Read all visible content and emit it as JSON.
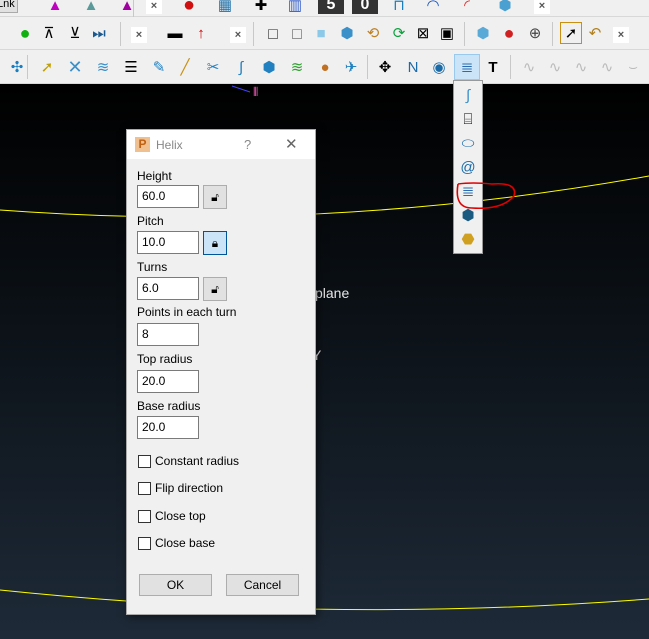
{
  "toolbar_row1": {
    "partial_label": "Lnk",
    "icons": [
      "pyramid-magenta-icon",
      "pyramid-teal-icon",
      "pyramid-download-icon",
      "close-toolbar",
      "error-icon",
      "calculator-icon",
      "pin-icon",
      "pattern-icon",
      "digit-5-icon",
      "digit-0-icon",
      "step-icon",
      "arc-icon",
      "dashed-arc-icon",
      "box-icon",
      "close-toolbar"
    ],
    "digit_5": "5",
    "digit_0": "0"
  },
  "toolbar_row2": {
    "groups": [
      [
        "green-dot-icon",
        "top-plane-icon",
        "bottom-plane-icon",
        "skip-end-icon"
      ],
      [
        "ruler-icon",
        "normal-arrow-icon"
      ],
      [
        "wireframe-cube-icon",
        "hidden-line-cube-icon",
        "shaded-cube-icon",
        "red-arrow-cube-icon",
        "zoom-undo-icon",
        "refresh-icon",
        "zoom-fit-icon",
        "zoom-box-icon"
      ],
      [
        "block-icon",
        "color-sphere-icon",
        "globe-icon"
      ],
      [
        "select-cursor-icon",
        "undo-select-icon"
      ]
    ],
    "close": "×"
  },
  "toolbar_row3": {
    "icons": [
      "workplane-icon",
      "select-icon",
      "curve-edit-icon",
      "wave-icon",
      "table-icon",
      "sketch-icon",
      "line-icon",
      "trim-icon",
      "spline-icon",
      "extrude-icon",
      "surface-icon",
      "palette-icon",
      "plane-icon",
      "points-icon",
      "polyline-icon",
      "circle-point-icon",
      "helix-icon",
      "text-icon",
      "disabled-1-icon",
      "disabled-2-icon",
      "disabled-3-icon",
      "disabled-4-icon",
      "disabled-5-icon"
    ]
  },
  "flyout": {
    "items": [
      "spline-curve-icon",
      "frame-curve-icon",
      "ellipse-icon",
      "spiral-icon",
      "helix-icon",
      "box-solid-icon",
      "pipe-icon"
    ],
    "highlight_color": "#e00000"
  },
  "viewport": {
    "text1": "plane",
    "text2": "Y",
    "curve_color": "#ffff00"
  },
  "dialog": {
    "title": "Helix",
    "help": "?",
    "close": "✕",
    "fields": [
      {
        "label": "Height",
        "value": "60.0",
        "lock": "unlocked"
      },
      {
        "label": "Pitch",
        "value": "10.0",
        "lock": "locked"
      },
      {
        "label": "Turns",
        "value": "6.0",
        "lock": "unlocked"
      },
      {
        "label": "Points in each turn",
        "value": "8"
      },
      {
        "label": "Top radius",
        "value": "20.0"
      },
      {
        "label": "Base radius",
        "value": "20.0"
      }
    ],
    "checkboxes": [
      {
        "label": "Constant radius",
        "checked": false
      },
      {
        "label": "Flip direction",
        "checked": false
      },
      {
        "label": "Close top",
        "checked": false
      },
      {
        "label": "Close base",
        "checked": false
      }
    ],
    "ok": "OK",
    "cancel": "Cancel"
  }
}
